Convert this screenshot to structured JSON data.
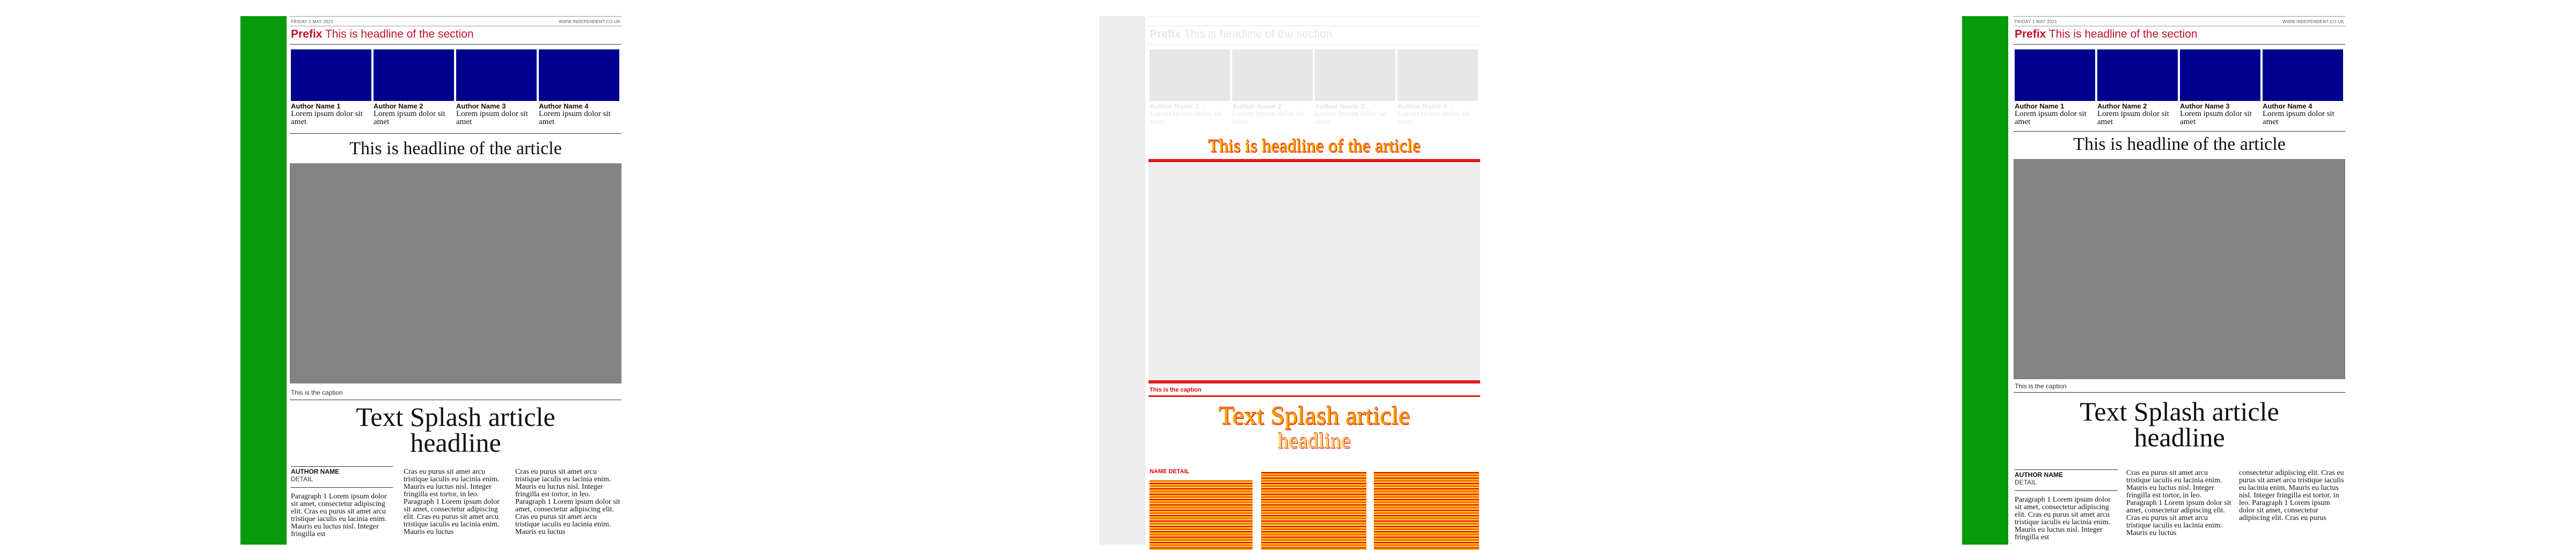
{
  "page": {
    "dateline": "FRIDAY 1 MAY 2021",
    "site": "WWW.INDEPENDENT.CO.UK",
    "section_prefix": "Prefix",
    "section_title": "This is headline of the section",
    "authors": [
      {
        "name": "Author Name 1",
        "bio": "Lorem ipsum dolor sit amet"
      },
      {
        "name": "Author Name 2",
        "bio": "Lorem ipsum dolor sit amet"
      },
      {
        "name": "Author Name 3",
        "bio": "Lorem ipsum dolor sit amet"
      },
      {
        "name": "Author Name 4",
        "bio": "Lorem ipsum dolor sit amet"
      }
    ],
    "headline": "This is headline of the article",
    "caption": "This is the caption",
    "splash_line1": "Text Splash article",
    "splash_line2": "headline",
    "author_name": "AUTHOR NAME",
    "author_detail": "DETAIL",
    "col1": "Paragraph 1 Lorem ipsum dolor sit amet, consectetur adipiscing elit. Cras eu purus sit amet arcu tristique iaculis eu lacinia enim. Mauris eu luctus nisl. Integer fringilla est",
    "col2": "Cras eu purus sit amet arcu tristique iaculis eu lacinia enim. Mauris eu luctus nisl. Integer fringilla est tortor, in leo. Paragraph 1 Lorem ipsum dolor sit amet, consectetur adipiscing elit. Cras eu purus sit amet arcu tristique iaculis eu lacinia enim. Mauris eu luctus",
    "col3": "Cras eu purus sit amet arcu tristique iaculis eu lacinia enim. Mauris eu luctus nisl. Integer fringilla est tortor, in leo. Paragraph 1 Lorem ipsum dolor sit amet, consectetur adipiscing elit. Cras eu purus sit amet arcu tristique iaculis eu lacinia enim. Mauris eu luctus",
    "col3b": "consectetur adipiscing elit. Cras eu purus sit amet arcu tristique iaculis eu lacinia enim. Mauris eu luctus nisl. Integer fringilla est tortor, in leo. Paragraph 1 Lorem ipsum dolor sit amet, consectetur adipiscing elit. Cras eu purus"
  },
  "glitch": {
    "name_fragment": "NAME DETAIL"
  },
  "colors": {
    "sidebar_green": "#079a0b",
    "accent_red": "#c4102b",
    "author_photo_blue": "#00008e",
    "hero_grey": "#838383"
  }
}
